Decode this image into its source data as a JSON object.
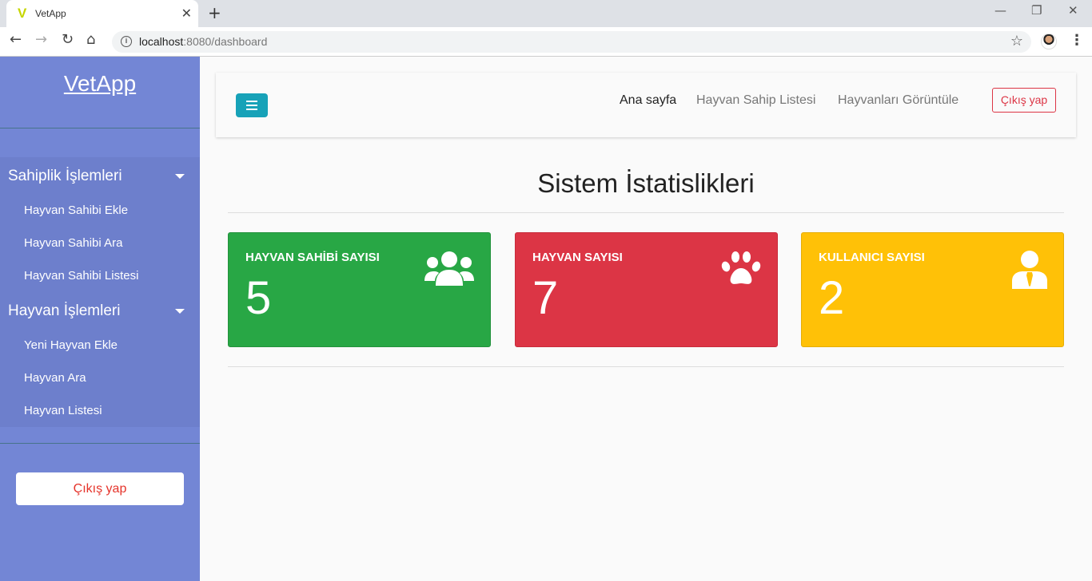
{
  "browser": {
    "tab_title": "VetApp",
    "tab_favicon": "V",
    "url_host": "localhost",
    "url_rest": ":8080/dashboard"
  },
  "sidebar": {
    "brand": "VetApp",
    "groups": [
      {
        "label": "Sahiplik İşlemleri",
        "items": [
          "Hayvan Sahibi Ekle",
          "Hayvan Sahibi Ara",
          "Hayvan Sahibi Listesi"
        ]
      },
      {
        "label": "Hayvan İşlemleri",
        "items": [
          "Yeni Hayvan Ekle",
          "Hayvan Ara",
          "Hayvan Listesi"
        ]
      }
    ],
    "logout_label": "Çıkış yap"
  },
  "navbar": {
    "links": [
      "Ana sayfa",
      "Hayvan Sahip Listesi",
      "Hayvanları Görüntüle"
    ],
    "logout_label": "Çıkış yap"
  },
  "main": {
    "title": "Sistem İstatislikleri",
    "cards": [
      {
        "label": "HAYVAN SAHİBİ SAYISI",
        "value": "5",
        "icon": "users-icon",
        "color": "#28a745"
      },
      {
        "label": "HAYVAN SAYISI",
        "value": "7",
        "icon": "paw-icon",
        "color": "#dc3545"
      },
      {
        "label": "KULLANICI SAYISI",
        "value": "2",
        "icon": "user-tie-icon",
        "color": "#ffc107"
      }
    ]
  },
  "colors": {
    "sidebar": "#7386d5",
    "sidebar_menu": "#6d7fcc",
    "toggle": "#17a2b8",
    "danger": "#dc3545"
  }
}
